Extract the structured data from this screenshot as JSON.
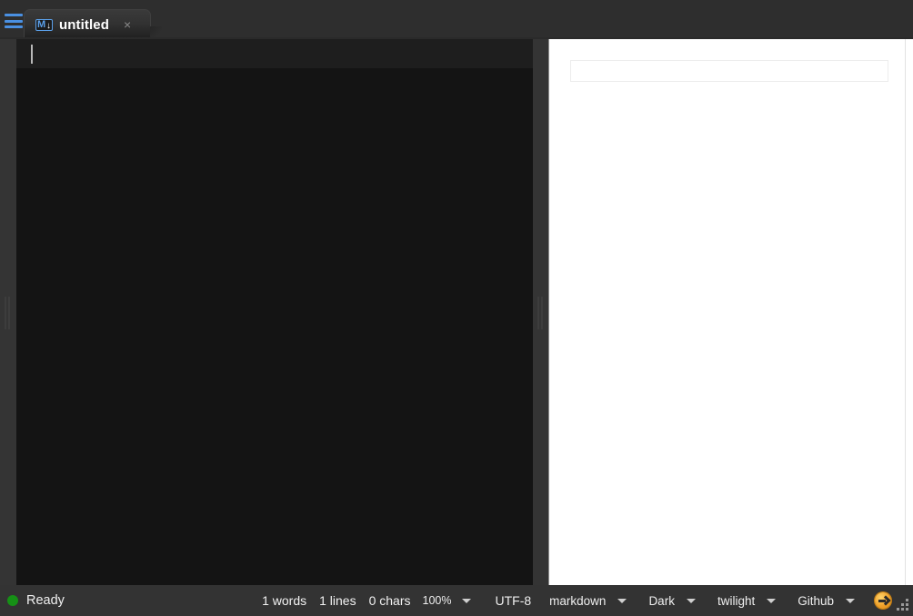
{
  "window": {
    "title": "untitled"
  },
  "titlebar": {
    "menu_icon": "hamburger-menu-icon",
    "tab": {
      "icon": "markdown-icon",
      "icon_letter": "M",
      "icon_arrow": "↓",
      "label": "untitled",
      "close_label": "×"
    }
  },
  "editor": {
    "content": "",
    "caret_visible": true
  },
  "preview": {
    "content": ""
  },
  "statusbar": {
    "status_label": "Ready",
    "status_dot_color": "#169016",
    "words": "1 words",
    "lines": "1 lines",
    "chars": "0 chars",
    "zoom": "100%",
    "encoding": "UTF-8",
    "syntax": "markdown",
    "ui_theme": "Dark",
    "editor_theme": "twilight",
    "preview_style": "Github",
    "go_icon": "go-arrow-icon",
    "resize_grip": "resize-grip-icon"
  }
}
